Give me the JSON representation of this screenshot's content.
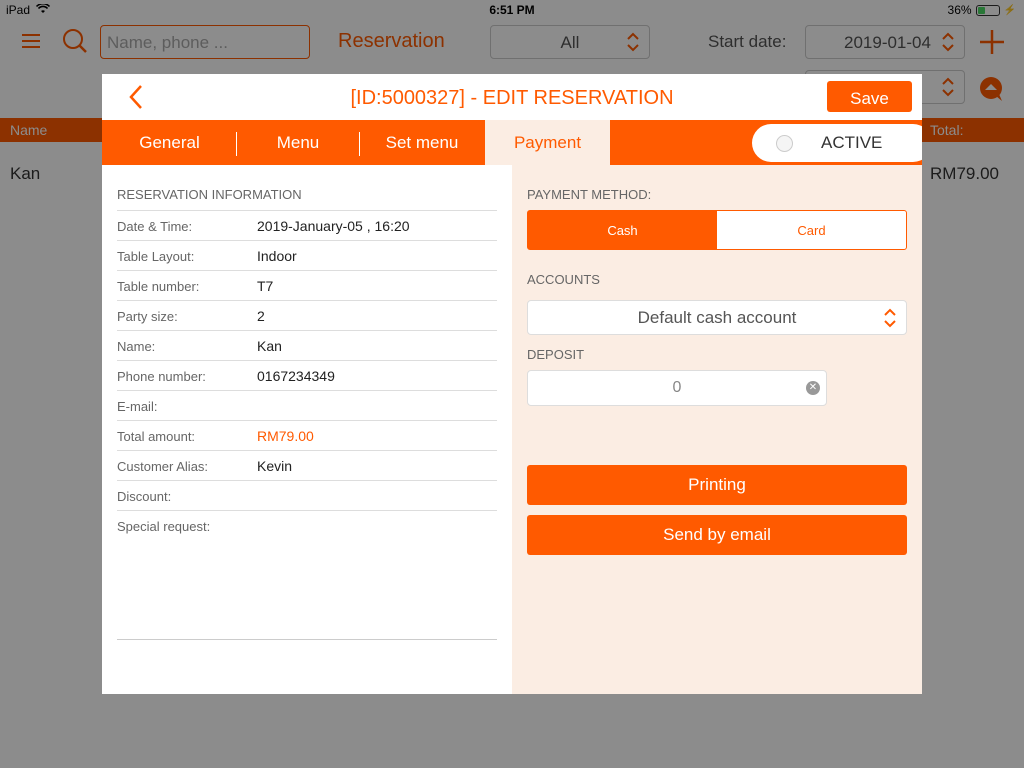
{
  "status_bar": {
    "device": "iPad",
    "time": "6:51 PM",
    "battery": "36%",
    "battery_level": 0.36
  },
  "top_bar": {
    "search_placeholder": "Name, phone ...",
    "title": "Reservation",
    "filter_value": "All",
    "start_date_label": "Start date:",
    "start_date_value": "2019-01-04"
  },
  "background_list": {
    "columns": {
      "name": "Name",
      "total": "Total:"
    },
    "row": {
      "name": "Kan",
      "total": "RM79.00"
    }
  },
  "modal": {
    "title": "[ID:5000327] - EDIT RESERVATION",
    "save_label": "Save",
    "tabs": [
      {
        "label": "General"
      },
      {
        "label": "Menu"
      },
      {
        "label": "Set menu"
      },
      {
        "label": "Payment"
      }
    ],
    "active_tab": "Payment",
    "toggle_label": "ACTIVE",
    "reservation_info": {
      "section_title": "RESERVATION INFORMATION",
      "rows": [
        {
          "label": "Date & Time:",
          "value": "2019-January-05 , 16:20"
        },
        {
          "label": "Table Layout:",
          "value": "Indoor"
        },
        {
          "label": "Table number:",
          "value": "T7"
        },
        {
          "label": "Party size:",
          "value": "2"
        },
        {
          "label": "Name:",
          "value": "Kan"
        },
        {
          "label": "Phone number:",
          "value": "0167234349"
        },
        {
          "label": "E-mail:",
          "value": ""
        },
        {
          "label": "Total amount:",
          "value": "RM79.00"
        },
        {
          "label": "Customer Alias:",
          "value": "Kevin"
        },
        {
          "label": "Discount:",
          "value": ""
        },
        {
          "label": "Special request:",
          "value": ""
        }
      ]
    },
    "payment": {
      "method_label": "PAYMENT METHOD:",
      "method_options": [
        "Cash",
        "Card"
      ],
      "method_selected": "Cash",
      "accounts_label": "ACCOUNTS",
      "account_value": "Default cash account",
      "deposit_label": "DEPOSIT",
      "deposit_value": "0",
      "printing_label": "Printing",
      "email_label": "Send by email"
    }
  },
  "colors": {
    "accent": "#ff5a00",
    "panel_bg": "#fbede3"
  }
}
